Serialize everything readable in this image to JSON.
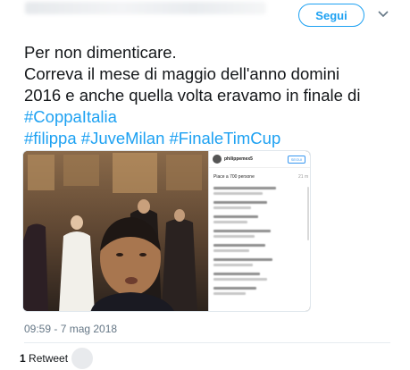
{
  "header": {
    "follow_label": "Segui",
    "menu_icon": "chevron-down-icon"
  },
  "tweet": {
    "lines": [
      "Per non dimenticare.",
      "Correva il mese di maggio dell'anno domini",
      "2016 e anche quella volta eravamo in finale di"
    ],
    "hashtags": {
      "coppa": "#CoppaItalia",
      "filippa": "#filippa",
      "juvemilan": "#JuveMilan",
      "finale": "#FinaleTimCup"
    }
  },
  "media": {
    "instagram": {
      "username": "philippemex5",
      "follow_label": "SEGUI",
      "likes": "Piace a 700 persone",
      "time": "21 m"
    }
  },
  "footer": {
    "timestamp": "09:59 - 7 mag 2018",
    "retweet_count": "1",
    "retweet_label": "Retweet"
  },
  "colors": {
    "accent": "#1da1f2",
    "text": "#14171a",
    "muted": "#657786"
  }
}
